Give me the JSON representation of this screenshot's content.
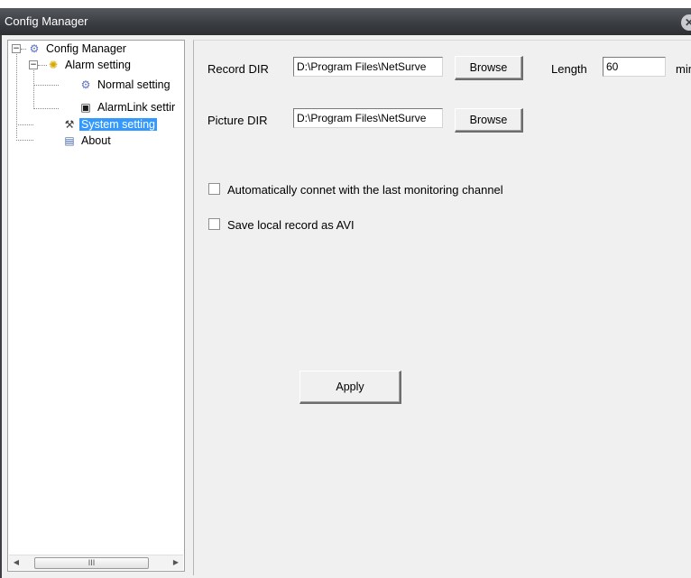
{
  "window": {
    "title": "Config Manager",
    "close_glyph": "✕"
  },
  "tree": {
    "expander_expanded": "−",
    "items": [
      {
        "label": "Config Manager",
        "icon": "gear-icon",
        "icon_glyph": "⚙"
      },
      {
        "label": "Alarm setting",
        "icon": "alarm-icon",
        "icon_glyph": "✺"
      },
      {
        "label": "Normal setting",
        "icon": "gear-icon",
        "icon_glyph": "⚙"
      },
      {
        "label": "AlarmLink settir",
        "icon": "monitor-icon",
        "icon_glyph": "▣"
      },
      {
        "label": "System setting",
        "icon": "tools-icon",
        "icon_glyph": "⚒"
      },
      {
        "label": "About",
        "icon": "about-icon",
        "icon_glyph": "▤"
      }
    ],
    "scrollbar": {
      "left_arrow": "◀",
      "right_arrow": "▶",
      "thumb_grip": "III"
    }
  },
  "form": {
    "record_dir": {
      "label": "Record DIR",
      "value": "D:\\Program Files\\NetSurve",
      "browse_label": "Browse"
    },
    "picture_dir": {
      "label": "Picture DIR",
      "value": "D:\\Program Files\\NetSurve",
      "browse_label": "Browse"
    },
    "length": {
      "label": "Length",
      "value": "60",
      "unit": "min"
    },
    "auto_connect": {
      "label": "Automatically connet with the last monitoring channel",
      "checked": false
    },
    "save_avi": {
      "label": "Save local record as AVI",
      "checked": false
    },
    "apply_label": "Apply"
  }
}
